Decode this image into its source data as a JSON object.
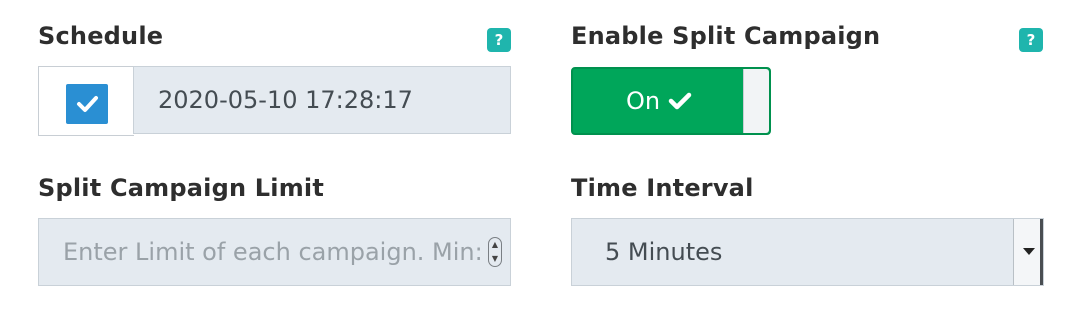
{
  "schedule": {
    "label": "Schedule",
    "help": "?",
    "checked": true,
    "datetime_value": "2020-05-10 17:28:17"
  },
  "split_campaign": {
    "label": "Enable Split Campaign",
    "help": "?",
    "toggle_label": "On",
    "toggle_state": "on"
  },
  "split_limit": {
    "label": "Split Campaign Limit",
    "placeholder": "Enter Limit of each campaign. Min:"
  },
  "time_interval": {
    "label": "Time Interval",
    "selected": "5 Minutes"
  },
  "colors": {
    "help_badge": "#1fb5ad",
    "checkbox": "#2a8fd3",
    "toggle_on": "#00a65a",
    "input_bg": "#e4eaf0"
  }
}
